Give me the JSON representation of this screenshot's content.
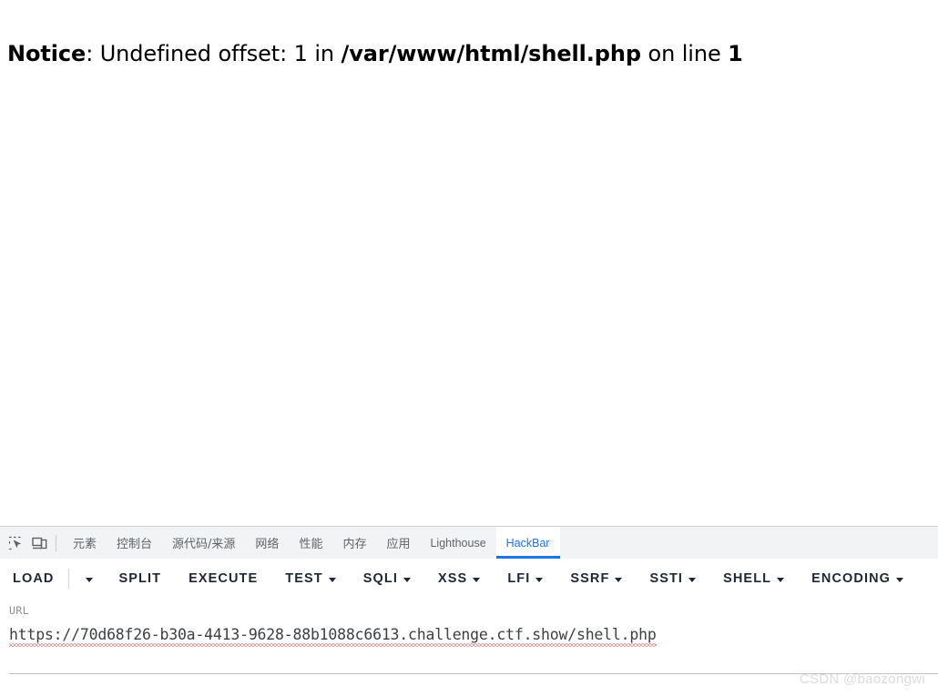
{
  "page": {
    "notice": {
      "label": "Notice",
      "colon": ": ",
      "message": "Undefined offset: 1 in ",
      "file": "/var/www/html/shell.php",
      "on_line": " on line ",
      "line_number": "1"
    }
  },
  "devtools": {
    "icons": [
      {
        "name": "inspect-element-icon",
        "title": "inspect"
      },
      {
        "name": "device-toolbar-icon",
        "title": "device toolbar"
      }
    ],
    "tabs": [
      {
        "label": "元素",
        "cjk": true,
        "active": false
      },
      {
        "label": "控制台",
        "cjk": true,
        "active": false
      },
      {
        "label": "源代码/来源",
        "cjk": true,
        "active": false
      },
      {
        "label": "网络",
        "cjk": true,
        "active": false
      },
      {
        "label": "性能",
        "cjk": true,
        "active": false
      },
      {
        "label": "内存",
        "cjk": true,
        "active": false
      },
      {
        "label": "应用",
        "cjk": true,
        "active": false
      },
      {
        "label": "Lighthouse",
        "cjk": false,
        "active": false
      },
      {
        "label": "HackBar",
        "cjk": false,
        "active": true
      }
    ],
    "active_tab_color": "#1a73e8",
    "tabbar_background": "#f1f3f4"
  },
  "hackbar": {
    "buttons": [
      {
        "label": "LOAD",
        "caret": false
      },
      {
        "label": "SPLIT",
        "caret": false
      },
      {
        "label": "EXECUTE",
        "caret": false
      },
      {
        "label": "TEST",
        "caret": true
      },
      {
        "label": "SQLI",
        "caret": true
      },
      {
        "label": "XSS",
        "caret": true
      },
      {
        "label": "LFI",
        "caret": true
      },
      {
        "label": "SSRF",
        "caret": true
      },
      {
        "label": "SSTI",
        "caret": true
      },
      {
        "label": "SHELL",
        "caret": true
      },
      {
        "label": "ENCODING",
        "caret": true
      }
    ],
    "url": {
      "label": "URL",
      "value": "https://70d68f26-b30a-4413-9628-88b1088c6613.challenge.ctf.show/shell.php",
      "placeholder": "URL"
    }
  },
  "watermark": {
    "text": "CSDN @baozongwi"
  }
}
